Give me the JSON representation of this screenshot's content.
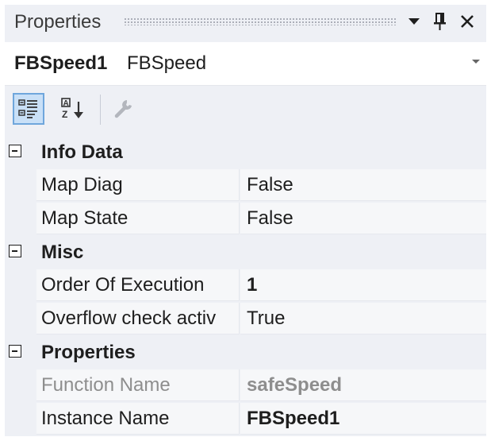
{
  "window": {
    "title": "Properties",
    "buttons": {
      "dropdown": "▼",
      "pin": "📌",
      "close": "✕"
    }
  },
  "selector": {
    "object_name": "FBSpeed1",
    "object_type": "FBSpeed"
  },
  "toolbar": {
    "categorized_icon": "categorized-icon",
    "alphabetical_icon": "alphabetical-icon",
    "property_pages_icon": "wrench-icon"
  },
  "grid": {
    "categories": [
      {
        "label": "Info Data",
        "rows": [
          {
            "name": "Map Diag",
            "value": "False"
          },
          {
            "name": "Map State",
            "value": "False"
          }
        ]
      },
      {
        "label": "Misc",
        "rows": [
          {
            "name": "Order Of Execution",
            "value": "1"
          },
          {
            "name": "Overflow check activ",
            "value": "True"
          }
        ]
      },
      {
        "label": "Properties",
        "rows": [
          {
            "name": "Function Name",
            "value": "safeSpeed"
          },
          {
            "name": "Instance Name",
            "value": "FBSpeed1"
          }
        ]
      }
    ]
  },
  "colors": {
    "panel_bg": "#eef0f5",
    "row_bg": "#f6f7f9",
    "disabled_text": "#8e8e8e",
    "active_tool_bg": "#c9e0f7"
  }
}
